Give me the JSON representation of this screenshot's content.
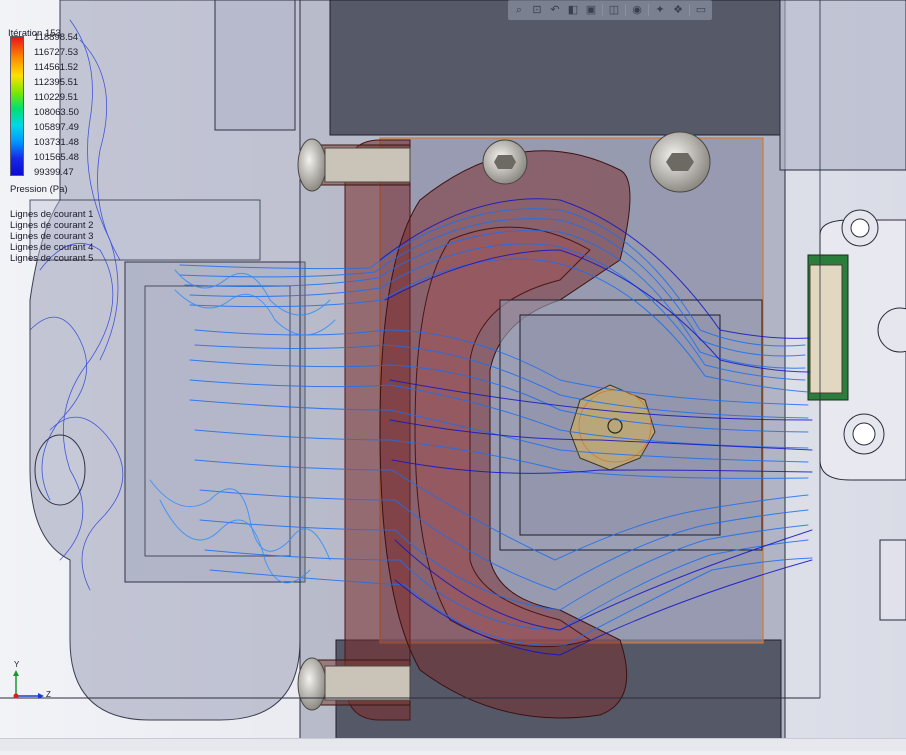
{
  "legend": {
    "title": "Itération 153",
    "variable": "Pression (Pa)",
    "ticks": [
      "118898.54",
      "116727.53",
      "114561.52",
      "112395.51",
      "110229.51",
      "108063.50",
      "105897.49",
      "103731.48",
      "101565.48",
      "99399.47"
    ],
    "streamlines": [
      "Lignes de courant 1",
      "Lignes de courant 2",
      "Lignes de courant 3",
      "Lignes de courant 4",
      "Lignes de courant 5"
    ],
    "colors": [
      "#e8141c",
      "#ff8a00",
      "#ffe000",
      "#7ee800",
      "#00e070",
      "#00d8e8",
      "#0096ff",
      "#1828e8",
      "#0a0ad8"
    ]
  },
  "toolbar": {
    "icons": [
      "zoom-to-fit-icon",
      "zoom-area-icon",
      "previous-view-icon",
      "section-view-icon",
      "view-orientation-icon",
      "display-style-icon",
      "hide-show-icon",
      "edit-appearance-icon",
      "apply-scene-icon",
      "view-settings-icon"
    ]
  },
  "triad": {
    "y": "Y",
    "z": "Z"
  },
  "colors": {
    "streamline": "#1f5ef0",
    "streamline_dark": "#1010c0",
    "part_red": "#7a2a2a",
    "part_grey": "#8a8fa8"
  }
}
